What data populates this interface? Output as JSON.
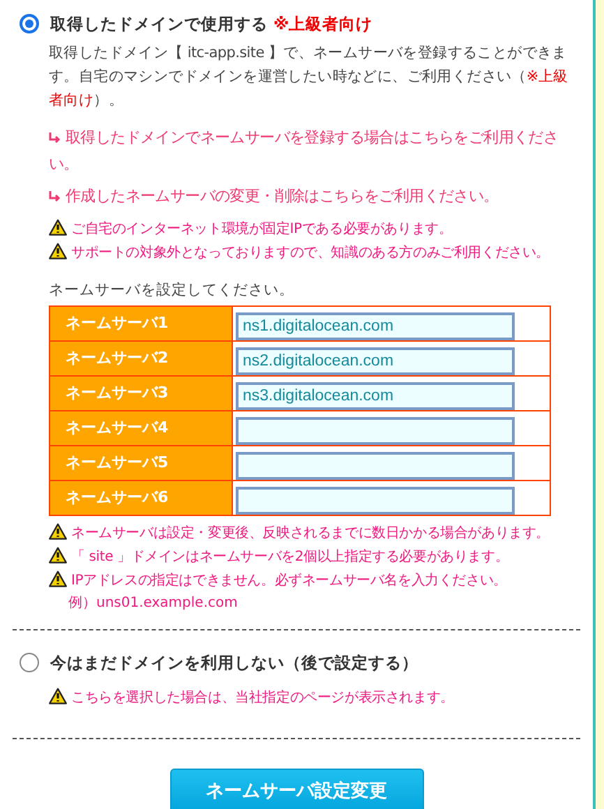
{
  "options": [
    {
      "label": "取得したドメインで使用する",
      "tag": "※上級者向け",
      "selected": true,
      "description": [
        {
          "kind": "plain",
          "text": "取得したドメイン【 itc-app.site 】で、ネームサーバを登録することができます。自宅のマシンでドメインを運営したい時などに、ご利用ください（"
        },
        {
          "kind": "alert",
          "text": "※上級者向け"
        },
        {
          "kind": "plain",
          "text": "）。"
        }
      ],
      "links": [
        "取得したドメインでネームサーバを登録する場合はこちらをご利用ください。",
        "作成したネームサーバの変更・削除はこちらをご利用ください。"
      ],
      "warnings": [
        "ご自宅のインターネット環境が固定IPである必要があります。",
        "サポートの対象外となっておりますので、知識のある方のみご利用ください。"
      ],
      "nameservers": {
        "prompt": "ネームサーバを設定してください。",
        "rows": [
          {
            "label": "ネームサーバ1",
            "value": "ns1.digitalocean.com"
          },
          {
            "label": "ネームサーバ2",
            "value": "ns2.digitalocean.com"
          },
          {
            "label": "ネームサーバ3",
            "value": "ns3.digitalocean.com"
          },
          {
            "label": "ネームサーバ4"
          },
          {
            "label": "ネームサーバ5"
          },
          {
            "label": "ネームサーバ6"
          }
        ],
        "notes": [
          "ネームサーバは設定・変更後、反映されるまでに数日かかる場合があります。",
          "「 site 」ドメインはネームサーバを2個以上指定する必要があります。",
          "IPアドレスの指定はできません。必ずネームサーバ名を入力ください。"
        ],
        "example": "例）uns01.example.com"
      }
    },
    {
      "label": "今はまだドメインを利用しない（後で設定する）",
      "selected": false,
      "warnings": [
        "こちらを選択した場合は、当社指定のページが表示されます。"
      ]
    }
  ],
  "submit_button": "ネームサーバ設定変更"
}
